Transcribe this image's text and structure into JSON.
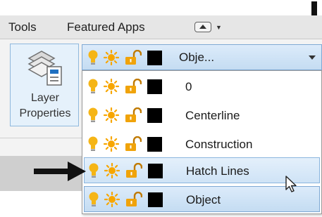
{
  "menubar": {
    "tools_label": "Tools",
    "featured_apps_label": "Featured Apps"
  },
  "layer_panel": {
    "button_label_line1": "Layer",
    "button_label_line2": "Properties"
  },
  "layer_combo": {
    "current_value": "Obje...",
    "current_color": "#000000"
  },
  "layer_list": {
    "items": [
      {
        "name": "0",
        "color": "#000000",
        "state": "normal"
      },
      {
        "name": "Centerline",
        "color": "#000000",
        "state": "normal"
      },
      {
        "name": "Construction",
        "color": "#000000",
        "state": "normal"
      },
      {
        "name": "Hatch Lines",
        "color": "#000000",
        "state": "hover"
      },
      {
        "name": "Object",
        "color": "#000000",
        "state": "selected"
      }
    ]
  },
  "theme": {
    "accent": "#7fa9d4",
    "bulb_color": "#f5b516",
    "sun_color": "#f7a600",
    "lock_color": "#f0a30a"
  },
  "icons": [
    "lightbulb-icon",
    "sun-icon",
    "unlocked-padlock-icon",
    "color-swatch",
    "arrow-down-annotation",
    "arrow-right-annotation",
    "mouse-cursor-icon"
  ]
}
